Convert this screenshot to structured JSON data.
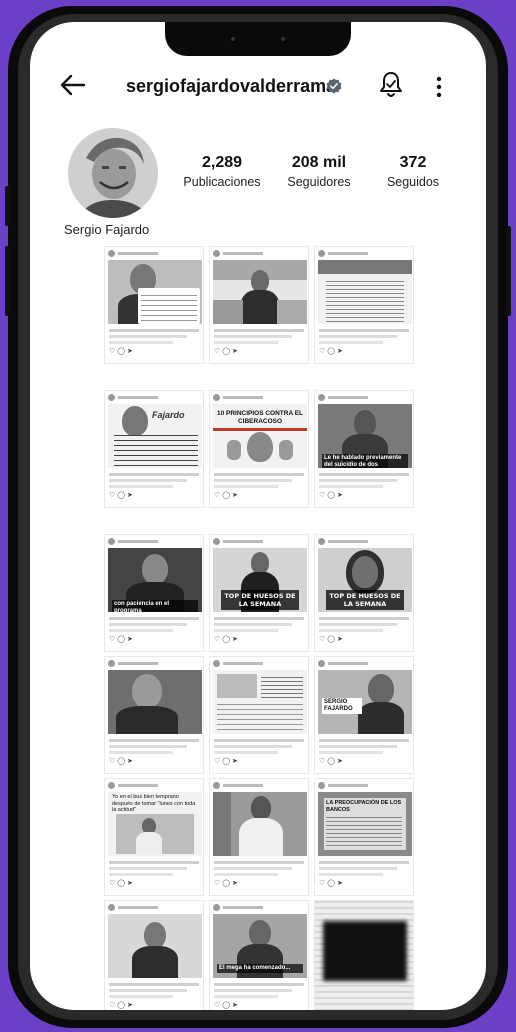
{
  "profile": {
    "username": "sergiofajardovalderrama",
    "display_name": "Sergio Fajardo",
    "stats": {
      "posts": {
        "value": "2,289",
        "label": "Publicaciones"
      },
      "followers": {
        "value": "208 mil",
        "label": "Seguidores"
      },
      "following": {
        "value": "372",
        "label": "Seguidos"
      }
    }
  },
  "posts": {
    "p4_title": "10 PRINCIPIOS CONTRA EL CIBERACOSO",
    "p5_caption": "Le he hablado previamente del suicidio de dos personas",
    "p6_caption": "con paciencia en el programa",
    "p8_title": "TOP DE HUESOS DE LA SEMANA",
    "p9_title": "TOP DE HUESOS DE LA SEMANA",
    "p12_name": "SERGIO FAJARDO",
    "p13_tweet": "Yo en el bus bien temprano después de tomar \"lunes con toda la actitud\"",
    "p15_caption": "LA PREOCUPACIÓN DE LOS BANCOS",
    "p17_caption": "El mega ha comenzado..."
  },
  "icons": {
    "back": "arrow-left-icon",
    "verified": "verified-badge-icon",
    "bell": "notification-bell-icon",
    "more": "more-options-icon"
  },
  "colors": {
    "background": "#6b3fc6",
    "verified": "#3897f0"
  }
}
